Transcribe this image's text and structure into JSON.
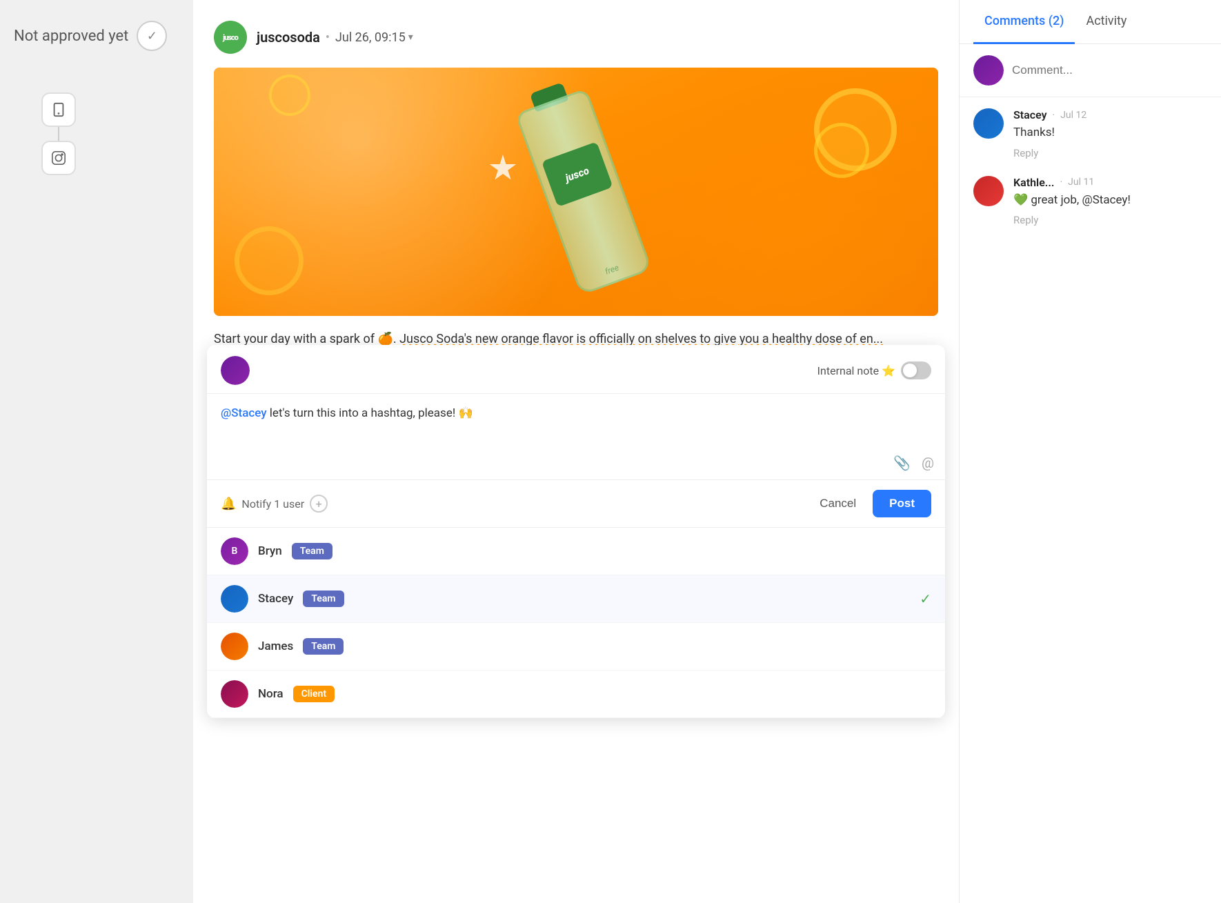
{
  "status": {
    "label": "Not approved yet"
  },
  "post": {
    "brand": "juscosoda",
    "brand_initial": "jusco",
    "date": "Jul 26, 09:15",
    "caption": "Start your day with a spark of 🍊. Jusco Soda's new orange flavor is officially on shelves to give you a healthy dose of en..."
  },
  "comment_composer": {
    "internal_note_label": "Internal note",
    "mention": "@Stacey",
    "text": " let's turn this into a hashtag, please! 🙌",
    "notify_label": "Notify 1 user",
    "cancel_label": "Cancel",
    "post_label": "Post"
  },
  "users": [
    {
      "name": "Bryn",
      "badge": "Team",
      "badge_type": "team",
      "selected": false
    },
    {
      "name": "Stacey",
      "badge": "Team",
      "badge_type": "team",
      "selected": true
    },
    {
      "name": "James",
      "badge": "Team",
      "badge_type": "team",
      "selected": false
    },
    {
      "name": "Nora",
      "badge": "Client",
      "badge_type": "client",
      "selected": false
    }
  ],
  "right_panel": {
    "tabs": [
      {
        "label": "Comments (2)",
        "active": true
      },
      {
        "label": "Activity",
        "active": false
      }
    ],
    "comment_placeholder": "Comment...",
    "comments": [
      {
        "author": "Stacey",
        "date": "Jul 12",
        "content": "Thanks!",
        "reply_label": "Reply"
      },
      {
        "author": "Kathle...",
        "date": "Jul 11",
        "content": "💚 great job, @Stacey!",
        "reply_label": "Reply"
      }
    ]
  }
}
